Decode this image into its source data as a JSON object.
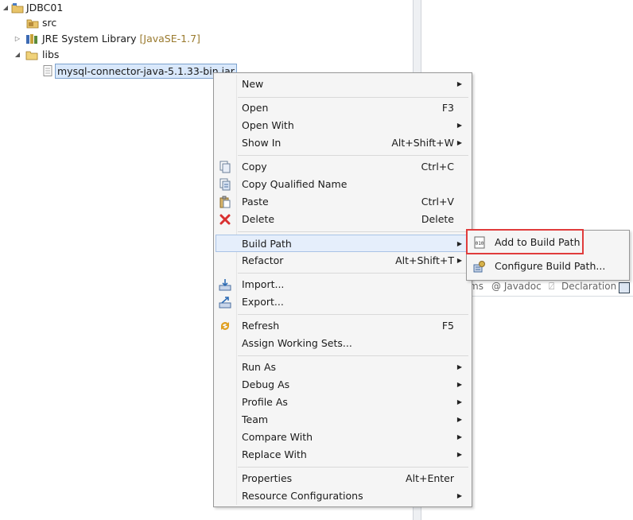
{
  "tree": {
    "project": "JDBC01",
    "src": "src",
    "jre_label": "JRE System Library",
    "jre_decor": "[JavaSE-1.7]",
    "libs": "libs",
    "jar": "mysql-connector-java-5.1.33-bin.jar"
  },
  "tabs": {
    "problems_fragment": "ms",
    "javadoc": "@ Javadoc",
    "declaration": "Declaration"
  },
  "menu": {
    "new": "New",
    "open": "Open",
    "open_acc": "F3",
    "open_with": "Open With",
    "show_in": "Show In",
    "show_in_acc": "Alt+Shift+W",
    "copy": "Copy",
    "copy_acc": "Ctrl+C",
    "copy_qualified": "Copy Qualified Name",
    "paste": "Paste",
    "paste_acc": "Ctrl+V",
    "delete": "Delete",
    "delete_acc": "Delete",
    "build_path": "Build Path",
    "refactor": "Refactor",
    "refactor_acc": "Alt+Shift+T",
    "import": "Import...",
    "export": "Export...",
    "refresh": "Refresh",
    "refresh_acc": "F5",
    "assign_ws": "Assign Working Sets...",
    "run_as": "Run As",
    "debug_as": "Debug As",
    "profile_as": "Profile As",
    "team": "Team",
    "compare_with": "Compare With",
    "replace_with": "Replace With",
    "properties": "Properties",
    "properties_acc": "Alt+Enter",
    "resource_configs": "Resource Configurations"
  },
  "submenu": {
    "add_to_build_path": "Add to Build Path",
    "configure_build_path": "Configure Build Path..."
  },
  "colors": {
    "highlight_border": "#e03c3c",
    "menu_bg": "#f5f5f5"
  }
}
